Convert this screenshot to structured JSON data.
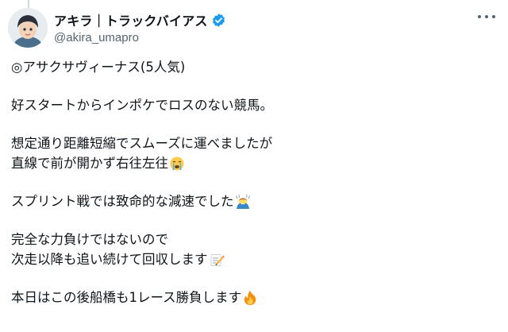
{
  "user": {
    "display_name": "アキラ｜トラックバイアス",
    "handle": "@akira_umapro"
  },
  "icons": {
    "avatar": "avatar",
    "verified": "verified-badge-icon",
    "more": "more-options-icon"
  },
  "colors": {
    "verified_blue": "#1d9bf0",
    "text": "#0f1419",
    "secondary": "#536471"
  },
  "tweet": {
    "l1": "◎アサクサヴィーナス(5人気)",
    "l2": "好スタートからインポケでロスのない競馬。",
    "l3": "想定通り距離短縮でスムーズに運べましたが",
    "l4": "直線で前が開かず右往左往",
    "l4_emoji": "crying-face-icon",
    "l5": "スプリント戦では致命的な減速でした",
    "l5_emoji": "person-bowing-icon",
    "l6": "完全な力負けではないので",
    "l7": "次走以降も追い続けて回収します",
    "l7_emoji": "memo-icon",
    "l8": "本日はこの後船橋も1レース勝負します",
    "l8_emoji": "fire-icon"
  }
}
